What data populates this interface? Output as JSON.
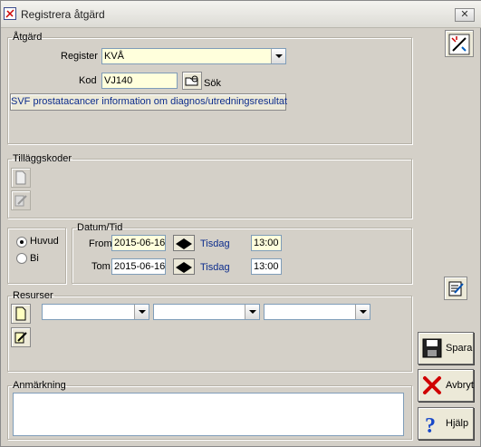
{
  "window": {
    "title": "Registrera åtgärd",
    "close_label": "☒"
  },
  "atgard": {
    "legend": "Åtgärd",
    "register_label": "Register",
    "register_value": "KVÅ",
    "kod_label": "Kod",
    "kod_value": "VJ140",
    "sok_label": "Sök",
    "description_button": "SVF prostatacancer information om diagnos/utredningsresultat"
  },
  "tillaggskoder": {
    "legend": "Tilläggskoder"
  },
  "type": {
    "huvud_label": "Huvud",
    "bi_label": "Bi",
    "selected": "Huvud"
  },
  "datum": {
    "legend": "Datum/Tid",
    "from_label": "From",
    "from_date": "2015-06-16",
    "from_weekday": "Tisdag",
    "from_time": "13:00",
    "tom_label": "Tom",
    "tom_date": "2015-06-16",
    "tom_weekday": "Tisdag",
    "tom_time": "13:00"
  },
  "resurser": {
    "legend": "Resurser",
    "combos": [
      "",
      "",
      ""
    ]
  },
  "anmarkning": {
    "legend": "Anmärkning",
    "value": ""
  },
  "buttons": {
    "spara": "Spara",
    "avbryt": "Avbryt",
    "hjalp": "Hjälp"
  }
}
